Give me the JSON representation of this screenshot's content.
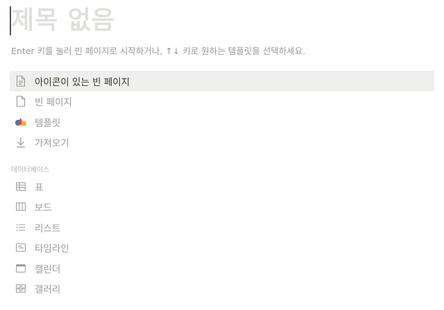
{
  "title": {
    "placeholder": "제목 없음"
  },
  "hint": "Enter 키를 눌러 빈 페이지로 시작하거나, ↑↓ 키로 원하는 템플릿을 선택하세요.",
  "options": [
    {
      "label": "아이콘이 있는 빈 페이지",
      "icon": "document-text-icon",
      "selected": true
    },
    {
      "label": "빈 페이지",
      "icon": "document-icon",
      "selected": false
    },
    {
      "label": "템플릿",
      "icon": "templates-icon",
      "selected": false
    },
    {
      "label": "가져오기",
      "icon": "download-arrow-icon",
      "selected": false
    }
  ],
  "database_section": {
    "label": "데이터베이스",
    "items": [
      {
        "label": "표",
        "icon": "table-icon"
      },
      {
        "label": "보드",
        "icon": "board-icon"
      },
      {
        "label": "리스트",
        "icon": "list-icon"
      },
      {
        "label": "타임라인",
        "icon": "timeline-icon"
      },
      {
        "label": "캘린더",
        "icon": "calendar-icon"
      },
      {
        "label": "갤러리",
        "icon": "gallery-icon"
      }
    ]
  },
  "colors": {
    "selected_background": "#efefee",
    "muted_text": "#9b9a97",
    "primary_text": "#37352f",
    "placeholder_text": "#e1e0dd"
  }
}
